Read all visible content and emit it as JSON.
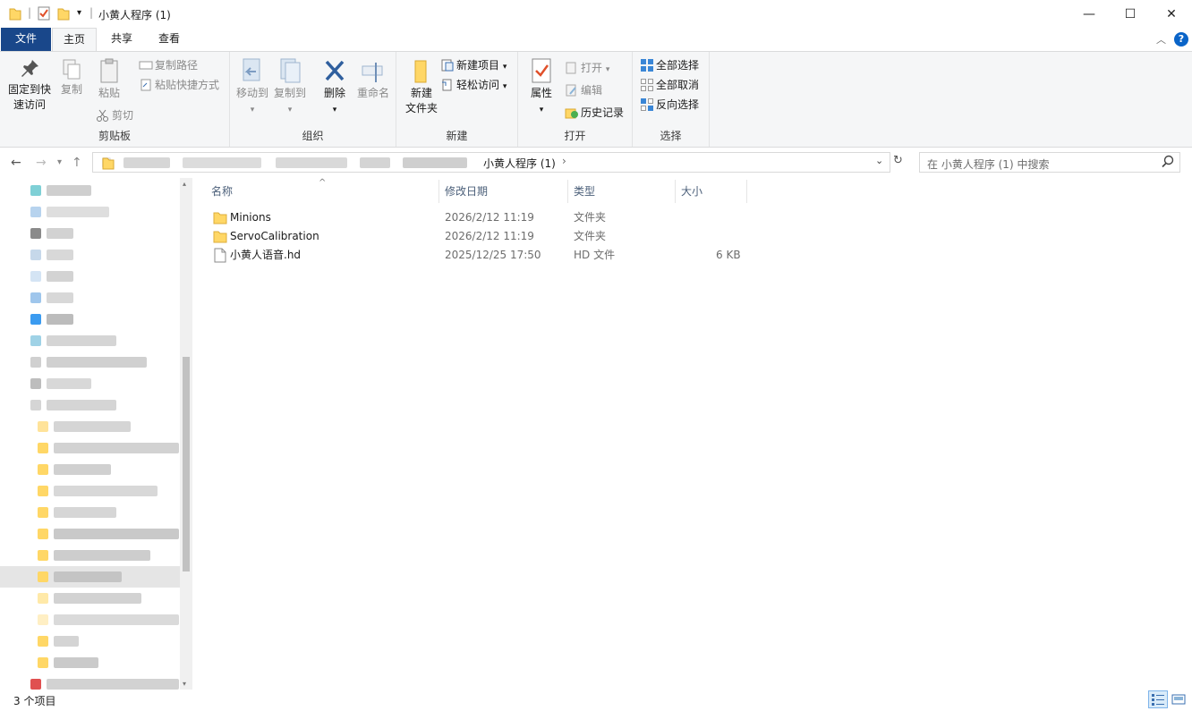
{
  "window": {
    "title": "小黄人程序 (1)",
    "controls": {
      "minimize": "—",
      "maximize": "☐",
      "close": "✕"
    }
  },
  "tabs": [
    {
      "label": "文件"
    },
    {
      "label": "主页"
    },
    {
      "label": "共享"
    },
    {
      "label": "查看"
    }
  ],
  "ribbon": {
    "clipboard": {
      "group_label": "剪贴板",
      "pin_line1": "固定到快",
      "pin_line2": "速访问",
      "copy": "复制",
      "paste": "粘贴",
      "copy_path": "复制路径",
      "paste_shortcut": "粘贴快捷方式",
      "cut": "剪切"
    },
    "organize": {
      "group_label": "组织",
      "move_to": "移动到",
      "copy_to": "复制到",
      "delete": "删除",
      "rename": "重命名"
    },
    "new": {
      "group_label": "新建",
      "new_folder_line1": "新建",
      "new_folder_line2": "文件夹",
      "new_item": "新建项目",
      "easy_access": "轻松访问"
    },
    "open": {
      "group_label": "打开",
      "properties": "属性",
      "open": "打开",
      "edit": "编辑",
      "history": "历史记录"
    },
    "select": {
      "group_label": "选择",
      "select_all": "全部选择",
      "select_none": "全部取消",
      "invert": "反向选择"
    }
  },
  "address": {
    "current_folder": "小黄人程序 (1)",
    "search_placeholder": "在 小黄人程序 (1) 中搜索"
  },
  "columns": {
    "name": "名称",
    "modified": "修改日期",
    "type": "类型",
    "size": "大小"
  },
  "files": [
    {
      "name": "Minions",
      "modified": "2026/2/12 11:19",
      "type": "文件夹",
      "size": "",
      "kind": "folder"
    },
    {
      "name": "ServoCalibration",
      "modified": "2026/2/12 11:19",
      "type": "文件夹",
      "size": "",
      "kind": "folder"
    },
    {
      "name": "小黄人语音.hd",
      "modified": "2025/12/25 17:50",
      "type": "HD 文件",
      "size": "6 KB",
      "kind": "file"
    }
  ],
  "status": {
    "item_count": "3 个项目"
  },
  "colors": {
    "file_tab": "#19478a",
    "folder": "#ffd766",
    "accent": "#0078d7"
  }
}
